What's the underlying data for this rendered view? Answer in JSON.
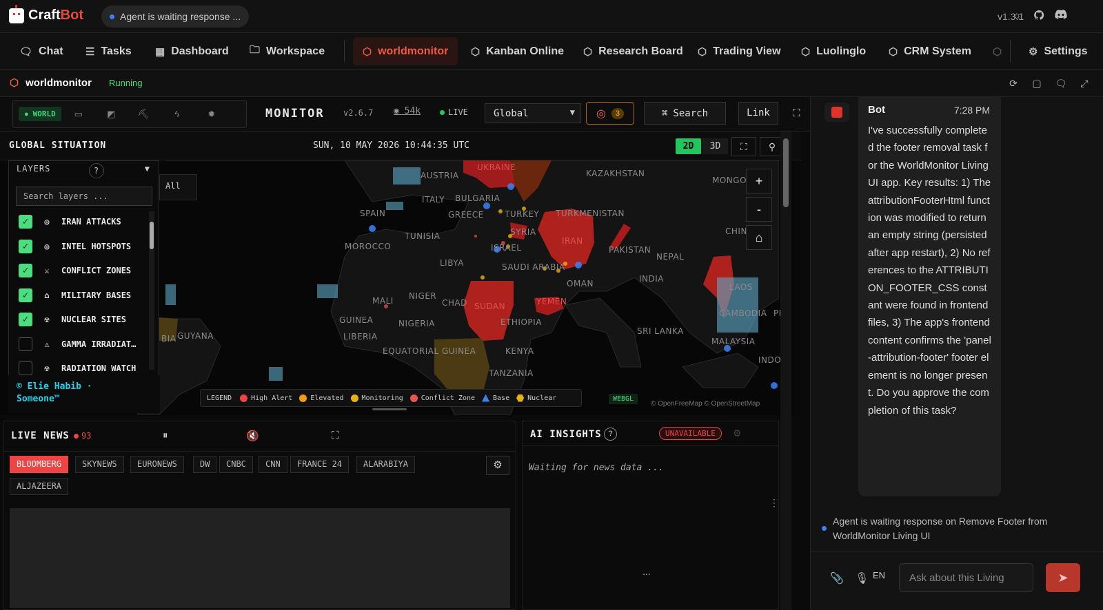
{
  "brand": {
    "name_a": "Craft",
    "name_b": "Bot"
  },
  "status_pill": {
    "text": "Agent is waiting response ...",
    "dot_color": "#3b82f6"
  },
  "version": "v1.3.1",
  "nav": {
    "chat": "Chat",
    "tasks": "Tasks",
    "dashboard": "Dashboard",
    "workspace": "Workspace",
    "worldmonitor": "worldmonitor",
    "kanban": "Kanban Online",
    "research": "Research Board",
    "trading": "Trading View",
    "luolinglo": "Luolinglo",
    "crm": "CRM System",
    "settings": "Settings"
  },
  "app": {
    "title": "worldmonitor",
    "status": "Running"
  },
  "monitor": {
    "variant_label": "WORLD",
    "title": "MONITOR",
    "version": "v2.6.7",
    "github_stars": "54k",
    "live": "LIVE",
    "region": "Global",
    "alerts_count": "3",
    "search": "Search",
    "link": "Link"
  },
  "situation": {
    "title": "GLOBAL SITUATION",
    "datetime": "SUN, 10 MAY 2026 10:44:35 UTC",
    "mode_2d": "2D",
    "mode_3d": "3D"
  },
  "layers": {
    "title": "LAYERS",
    "help": "?",
    "search_placeholder": "Search layers ...",
    "items": [
      {
        "label": "IRAN ATTACKS",
        "checked": true,
        "icon": "target-icon"
      },
      {
        "label": "INTEL HOTSPOTS",
        "checked": true,
        "icon": "target-icon"
      },
      {
        "label": "CONFLICT ZONES",
        "checked": true,
        "icon": "swords-icon"
      },
      {
        "label": "MILITARY BASES",
        "checked": true,
        "icon": "base-icon"
      },
      {
        "label": "NUCLEAR SITES",
        "checked": true,
        "icon": "radiation-icon"
      },
      {
        "label": "GAMMA IRRADIAT…",
        "checked": false,
        "icon": "warning-icon"
      },
      {
        "label": "RADIATION WATCH",
        "checked": false,
        "icon": "radiation-icon"
      }
    ],
    "all_button": "All",
    "attribution_line1": "© Elie Habib ·",
    "attribution_line2": "Someone™"
  },
  "map_labels": {
    "ukraine": "UKRAINE",
    "austria": "AUSTRIA",
    "bulgaria": "BULGARIA",
    "italy": "ITALY",
    "spain": "SPAIN",
    "greece": "GREECE",
    "turkey": "TURKEY",
    "turkmenistan": "TURKMENISTAN",
    "kazakhstan": "KAZAKHSTAN",
    "mongolia": "MONGO",
    "china": "CHIN",
    "tunisia": "TUNISIA",
    "syria": "SYRIA",
    "iran": "IRAN",
    "pakistan": "PAKISTAN",
    "israel": "ISRAEL",
    "morocco": "MOROCCO",
    "libya": "LIBYA",
    "saudi": "SAUDI ARABIA",
    "nepal": "NEPAL",
    "oman": "OMAN",
    "india": "INDIA",
    "laos": "LAOS",
    "mali": "MALI",
    "niger": "NIGER",
    "chad": "CHAD",
    "sudan": "SUDAN",
    "yemen": "YEMEN",
    "cambodia": "CAMBODIA",
    "ph": "PH",
    "guinea": "GUINEA",
    "nigeria": "NIGERIA",
    "ethiopia": "ETHIOPIA",
    "srilanka": "SRI LANKA",
    "liberia": "LIBERIA",
    "malaysia": "MALAYSIA",
    "eq_guinea": "EQUATORIAL GUINEA",
    "kenya": "KENYA",
    "indo": "INDO",
    "tanzania": "TANZANIA",
    "guyana": "GUYANA",
    "bia": "BIA"
  },
  "legend": {
    "title": "LEGEND",
    "items": [
      {
        "label": "High Alert",
        "color": "#ef4444"
      },
      {
        "label": "Elevated",
        "color": "#f59e0b"
      },
      {
        "label": "Monitoring",
        "color": "#eab308"
      },
      {
        "label": "Conflict Zone",
        "color": "#f05252"
      },
      {
        "label": "Base",
        "color": "#3b82f6"
      },
      {
        "label": "Nuclear",
        "color": "#eab308"
      }
    ]
  },
  "webgl": "WEBGL",
  "osm_credit": "© OpenFreeMap © OpenStreetMap",
  "live_news": {
    "title": "LIVE NEWS",
    "count": "93",
    "channels": [
      "BLOOMBERG",
      "SKYNEWS",
      "EURONEWS",
      "DW",
      "CNBC",
      "CNN",
      "FRANCE 24",
      "ALARABIYA",
      "ALJAZEERA"
    ]
  },
  "ai_insights": {
    "title": "AI INSIGHTS",
    "help": "?",
    "status": "UNAVAILABLE",
    "body": "Waiting for news data ...",
    "more": "..."
  },
  "chat": {
    "sender": "Bot",
    "time": "7:28 PM",
    "message": "I've successfully completed the footer removal task for the WorldMonitor Living UI app. Key results: 1) The attributionFooterHtml function was modified to return an empty string (persisted after app restart), 2) No references to the ATTRIBUTION_FOOTER_CSS constant were found in frontend files, 3) The app's frontend content confirms the 'panel-attribution-footer' footer element is no longer present. Do you approve the completion of this task?",
    "waiting_note": "Agent is waiting response on Remove Footer from WorldMonitor Living UI",
    "lang": "EN",
    "input_placeholder": "Ask about this Living"
  }
}
